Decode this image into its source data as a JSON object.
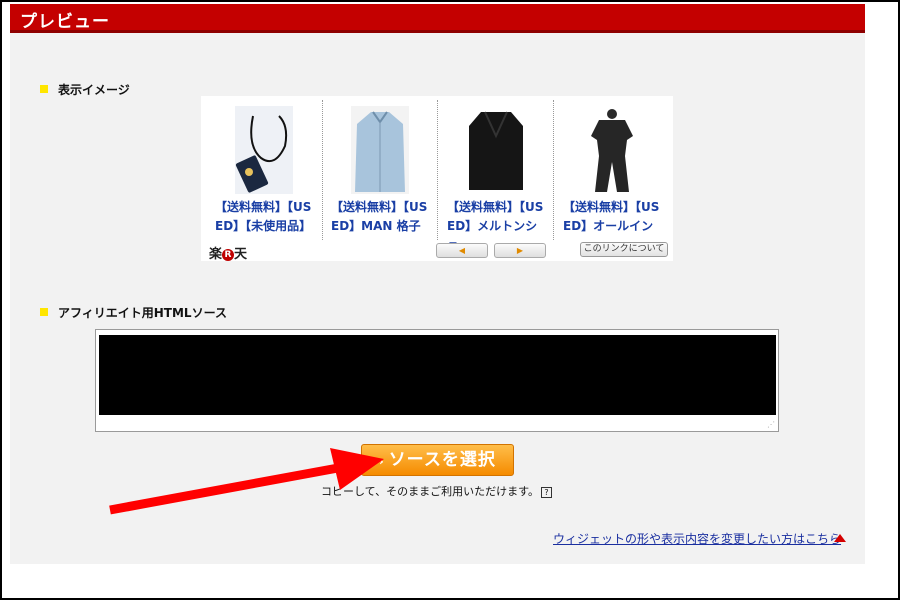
{
  "header": {
    "title": "プレビュー"
  },
  "sections": {
    "display_image": "表示イメージ",
    "html_source": "アフィリエイト用HTMLソース"
  },
  "widget": {
    "items": [
      {
        "line1": "【送料無料】【US",
        "line2": "ED】【未使用品】",
        "image": "lanyard-phone-case"
      },
      {
        "line1": "【送料無料】【US",
        "line2": "ED】MAN 格子",
        "image": "blue-shirt"
      },
      {
        "line1": "【送料無料】【US",
        "line2": "ED】メルトンショ",
        "image": "black-jacket"
      },
      {
        "line1": "【送料無料】【US",
        "line2": "ED】オールイン",
        "image": "black-jumpsuit"
      }
    ],
    "brand_left": "楽",
    "brand_mark": "R",
    "brand_right": "天",
    "prev_label": "◀",
    "next_label": "▶",
    "about_label": "このリンクについて"
  },
  "source": {
    "content": ""
  },
  "select_button": {
    "chevron": "›",
    "label": "ソースを選択"
  },
  "hint": {
    "text": "コピーして、そのままご利用いただけます。",
    "help_icon": "?"
  },
  "bottom_link": {
    "text": "ウィジェットの形や表示内容を変更したい方はこちら"
  },
  "colors": {
    "header": "#c40000",
    "button": "#f7941d",
    "link": "#1a2fa0",
    "bullet": "#ffe600",
    "arrow": "#ff0000"
  }
}
